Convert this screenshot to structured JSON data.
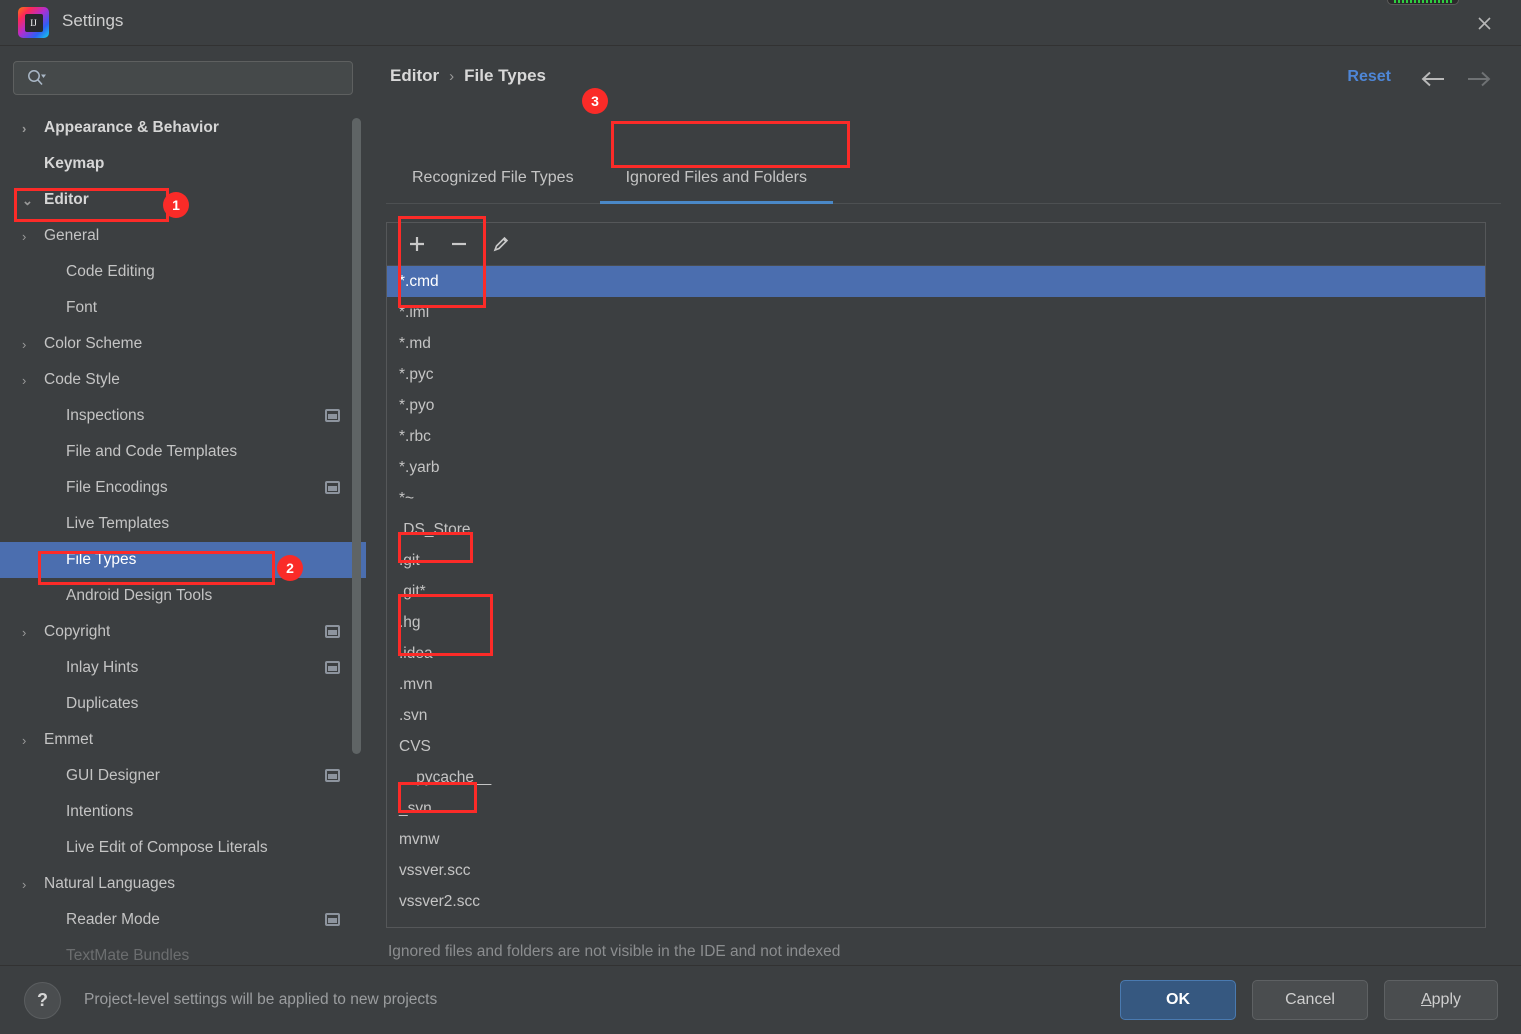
{
  "window": {
    "title": "Settings",
    "logo_icon": "intellij-idea-logo",
    "close_icon": "close-icon"
  },
  "search": {
    "value": "",
    "placeholder": "",
    "icon": "search-icon"
  },
  "sidebar": {
    "items": [
      {
        "label": "Appearance & Behavior",
        "indent": 0,
        "arrow": "›",
        "bold": true,
        "selected": false,
        "proj_icon": false
      },
      {
        "label": "Keymap",
        "indent": 1,
        "arrow": "",
        "bold": true,
        "selected": false,
        "proj_icon": false
      },
      {
        "label": "Editor",
        "indent": 0,
        "arrow": "⌄",
        "bold": true,
        "selected": false,
        "proj_icon": false
      },
      {
        "label": "General",
        "indent": 1,
        "arrow": "›",
        "bold": false,
        "selected": false,
        "proj_icon": false
      },
      {
        "label": "Code Editing",
        "indent": 2,
        "arrow": "",
        "bold": false,
        "selected": false,
        "proj_icon": false
      },
      {
        "label": "Font",
        "indent": 2,
        "arrow": "",
        "bold": false,
        "selected": false,
        "proj_icon": false
      },
      {
        "label": "Color Scheme",
        "indent": 1,
        "arrow": "›",
        "bold": false,
        "selected": false,
        "proj_icon": false
      },
      {
        "label": "Code Style",
        "indent": 1,
        "arrow": "›",
        "bold": false,
        "selected": false,
        "proj_icon": false
      },
      {
        "label": "Inspections",
        "indent": 2,
        "arrow": "",
        "bold": false,
        "selected": false,
        "proj_icon": true
      },
      {
        "label": "File and Code Templates",
        "indent": 2,
        "arrow": "",
        "bold": false,
        "selected": false,
        "proj_icon": false
      },
      {
        "label": "File Encodings",
        "indent": 2,
        "arrow": "",
        "bold": false,
        "selected": false,
        "proj_icon": true
      },
      {
        "label": "Live Templates",
        "indent": 2,
        "arrow": "",
        "bold": false,
        "selected": false,
        "proj_icon": false
      },
      {
        "label": "File Types",
        "indent": 2,
        "arrow": "",
        "bold": false,
        "selected": true,
        "proj_icon": false
      },
      {
        "label": "Android Design Tools",
        "indent": 2,
        "arrow": "",
        "bold": false,
        "selected": false,
        "proj_icon": false
      },
      {
        "label": "Copyright",
        "indent": 1,
        "arrow": "›",
        "bold": false,
        "selected": false,
        "proj_icon": true
      },
      {
        "label": "Inlay Hints",
        "indent": 2,
        "arrow": "",
        "bold": false,
        "selected": false,
        "proj_icon": true
      },
      {
        "label": "Duplicates",
        "indent": 2,
        "arrow": "",
        "bold": false,
        "selected": false,
        "proj_icon": false
      },
      {
        "label": "Emmet",
        "indent": 1,
        "arrow": "›",
        "bold": false,
        "selected": false,
        "proj_icon": false
      },
      {
        "label": "GUI Designer",
        "indent": 2,
        "arrow": "",
        "bold": false,
        "selected": false,
        "proj_icon": true
      },
      {
        "label": "Intentions",
        "indent": 2,
        "arrow": "",
        "bold": false,
        "selected": false,
        "proj_icon": false
      },
      {
        "label": "Live Edit of Compose Literals",
        "indent": 2,
        "arrow": "",
        "bold": false,
        "selected": false,
        "proj_icon": false
      },
      {
        "label": "Natural Languages",
        "indent": 1,
        "arrow": "›",
        "bold": false,
        "selected": false,
        "proj_icon": false
      },
      {
        "label": "Reader Mode",
        "indent": 2,
        "arrow": "",
        "bold": false,
        "selected": false,
        "proj_icon": true
      },
      {
        "label": "TextMate Bundles",
        "indent": 2,
        "arrow": "",
        "bold": false,
        "selected": false,
        "proj_icon": false
      }
    ]
  },
  "header": {
    "breadcrumb": {
      "parent": "Editor",
      "separator": "›",
      "current": "File Types"
    },
    "reset_label": "Reset",
    "back_icon": "arrow-left-icon",
    "forward_icon": "arrow-right-icon"
  },
  "tabs": [
    {
      "label": "Recognized File Types",
      "active": false
    },
    {
      "label": "Ignored Files and Folders",
      "active": true
    }
  ],
  "toolbar": {
    "add_icon": "plus-icon",
    "remove_icon": "minus-icon",
    "edit_icon": "pencil-icon"
  },
  "ignored_list": {
    "rows": [
      {
        "value": "*.cmd",
        "selected": true
      },
      {
        "value": "*.iml",
        "selected": false
      },
      {
        "value": "*.md",
        "selected": false
      },
      {
        "value": "*.pyc",
        "selected": false
      },
      {
        "value": "*.pyo",
        "selected": false
      },
      {
        "value": "*.rbc",
        "selected": false
      },
      {
        "value": "*.yarb",
        "selected": false
      },
      {
        "value": "*~",
        "selected": false
      },
      {
        "value": ".DS_Store",
        "selected": false
      },
      {
        "value": ".git",
        "selected": false
      },
      {
        "value": ".git*",
        "selected": false
      },
      {
        "value": ".hg",
        "selected": false
      },
      {
        "value": ".idea",
        "selected": false
      },
      {
        "value": ".mvn",
        "selected": false
      },
      {
        "value": ".svn",
        "selected": false
      },
      {
        "value": "CVS",
        "selected": false
      },
      {
        "value": "__pycache__",
        "selected": false
      },
      {
        "value": "_svn",
        "selected": false
      },
      {
        "value": "mvnw",
        "selected": false
      },
      {
        "value": "vssver.scc",
        "selected": false
      },
      {
        "value": "vssver2.scc",
        "selected": false
      }
    ],
    "hint": "Ignored files and folders are not visible in the IDE and not indexed"
  },
  "footer": {
    "help_icon": "help-icon",
    "note": "Project-level settings will be applied to new projects",
    "ok_label": "OK",
    "cancel_label": "Cancel",
    "apply_label_prefix": "A",
    "apply_label_rest": "pply"
  },
  "annotations": {
    "badges": [
      {
        "number": "1",
        "target": "sidebar-item-editor"
      },
      {
        "number": "2",
        "target": "sidebar-item-file-types"
      },
      {
        "number": "3",
        "target": "tab-ignored-files-and-folders"
      }
    ],
    "accent_color": "#fa2b28",
    "selection_color": "#4b6eaf",
    "link_color": "#4e86d6"
  }
}
